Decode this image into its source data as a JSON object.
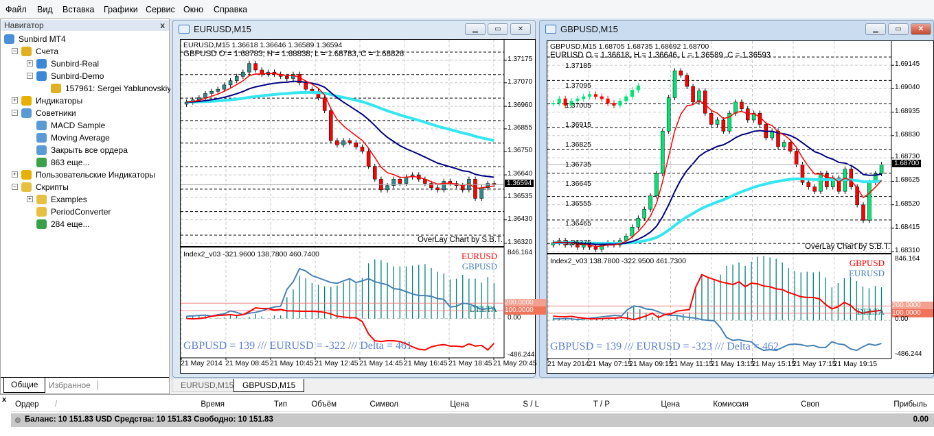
{
  "menu": [
    "Файл",
    "Вид",
    "Вставка",
    "Графики",
    "Сервис",
    "Окно",
    "Справка"
  ],
  "navigator": {
    "title": "Навигатор",
    "close": "x",
    "items": [
      {
        "label": "Sunbird MT4",
        "level": 0,
        "exp": "",
        "icon": "terminal"
      },
      {
        "label": "Счета",
        "level": 1,
        "exp": "−",
        "icon": "accounts"
      },
      {
        "label": "Sunbird-Real",
        "level": 2,
        "exp": "+",
        "icon": "server"
      },
      {
        "label": "Sunbird-Demo",
        "level": 2,
        "exp": "−",
        "icon": "server"
      },
      {
        "label": "157961: Sergei Yablunovskiy",
        "level": 3,
        "exp": "",
        "icon": "user"
      },
      {
        "label": "Индикаторы",
        "level": 1,
        "exp": "+",
        "icon": "indicator"
      },
      {
        "label": "Советники",
        "level": 1,
        "exp": "−",
        "icon": "expert"
      },
      {
        "label": "MACD Sample",
        "level": 2,
        "exp": "",
        "icon": "expert"
      },
      {
        "label": "Moving Average",
        "level": 2,
        "exp": "",
        "icon": "expert"
      },
      {
        "label": "Закрыть все ордера",
        "level": 2,
        "exp": "",
        "icon": "expert"
      },
      {
        "label": "863 еще...",
        "level": 2,
        "exp": "",
        "icon": "globe"
      },
      {
        "label": "Пользовательские Индикаторы",
        "level": 1,
        "exp": "+",
        "icon": "indicator"
      },
      {
        "label": "Скрипты",
        "level": 1,
        "exp": "−",
        "icon": "script"
      },
      {
        "label": "Examples",
        "level": 2,
        "exp": "+",
        "icon": "script"
      },
      {
        "label": "PeriodConverter",
        "level": 2,
        "exp": "",
        "icon": "script"
      },
      {
        "label": "284 еще...",
        "level": 2,
        "exp": "",
        "icon": "globe"
      }
    ],
    "tabs": [
      "Общие",
      "Избранное"
    ]
  },
  "colors": {
    "bull": "#00e676",
    "bear": "#ff0000",
    "ema_fast": "#ff0000",
    "ema_mid": "#000080",
    "ema_slow": "#33e6f0",
    "ind_red": "#ff0000",
    "ind_blue": "#4682b4",
    "delta": "#008080",
    "level": "#f08080",
    "teal_candle": "#2e8b8b"
  },
  "charts": [
    {
      "window_title": "EURUSD,M15",
      "active": false,
      "header": "EURUSD,M15  1.36618 1.36646 1.36589 1.36594",
      "overlay_info": "GBPUSD O = 1.68783, H = 1.68838, L = 1.68783, C = 1.68826",
      "watermark": "OverLay Chart by S.B.T.",
      "price_labels": [
        "1.37175",
        "1.37070",
        "1.36960",
        "1.36855",
        "1.36750",
        "1.36640",
        "1.36535",
        "1.36430",
        "1.36320"
      ],
      "current_price": "1.36594",
      "ylim": [
        1.36304,
        1.37271
      ],
      "overlay_labels": [],
      "overlay_ylim": [
        1.36332,
        1.37305
      ],
      "closes": [
        1.3698,
        1.3699,
        1.37,
        1.3702,
        1.3703,
        1.3704,
        1.3706,
        1.3708,
        1.371,
        1.3712,
        1.3716,
        1.3713,
        1.3711,
        1.3712,
        1.3711,
        1.371,
        1.3709,
        1.3711,
        1.3707,
        1.3704,
        1.3703,
        1.37,
        1.3694,
        1.368,
        1.3678,
        1.368,
        1.3679,
        1.3677,
        1.3675,
        1.3668,
        1.3662,
        1.3657,
        1.3659,
        1.3662,
        1.366,
        1.3663,
        1.3664,
        1.3662,
        1.366,
        1.3658,
        1.3657,
        1.3661,
        1.366,
        1.3659,
        1.3657,
        1.3662,
        1.3653,
        1.3658,
        1.366,
        1.36594
      ],
      "overlay_closes": [],
      "indicator": {
        "header": "Index2_v03 -321.9600 138.7800 460.7400",
        "legend": [
          "EURUSD",
          "GBPUSD",
          "DELTA"
        ],
        "axis_labels": [
          "846.164",
          "0.00",
          "-486.244"
        ],
        "levels": [
          "200.0000",
          "100.0000"
        ],
        "ylim": [
          -513,
          917.7
        ],
        "summary": "GBPUSD = 139 /// EURUSD = -322 /// Delta = 461",
        "red": [
          0,
          -5,
          0,
          10,
          30,
          40,
          45,
          50,
          40,
          50,
          90,
          140,
          130,
          130,
          110,
          120,
          100,
          100,
          95,
          95,
          95,
          90,
          80,
          60,
          30,
          20,
          10,
          10,
          -40,
          -200,
          -290,
          -300,
          -290,
          -290,
          -300,
          -330,
          -370,
          -400,
          -410,
          -370,
          -350,
          -340,
          -360,
          -360,
          -370,
          -330,
          -360,
          -350,
          -410,
          -322
        ],
        "blue": [
          30,
          35,
          40,
          45,
          30,
          50,
          60,
          100,
          80,
          50,
          70,
          80,
          100,
          130,
          150,
          160,
          380,
          480,
          650,
          620,
          560,
          530,
          500,
          470,
          460,
          490,
          520,
          470,
          490,
          520,
          480,
          460,
          440,
          390,
          380,
          350,
          320,
          300,
          300,
          290,
          260,
          250,
          150,
          160,
          200,
          190,
          160,
          120,
          130,
          139
        ]
      },
      "time_labels": [
        "21 May 2014",
        "21 May 08:45",
        "21 May 10:45",
        "21 May 12:45",
        "21 May 14:45",
        "21 May 16:45",
        "21 May 18:45",
        "21 May 20:45"
      ]
    },
    {
      "window_title": "GBPUSD,M15",
      "active": true,
      "header": "GBPUSD,M15  1.68705 1.68735 1.68692 1.68700",
      "overlay_info": "EURUSD O = 1.36618, H = 1.36646, L = 1.36589, C = 1.36593",
      "watermark": "OverLay Chart by S.B.T.",
      "price_labels": [
        "1.69145",
        "1.69040",
        "1.68935",
        "1.68830",
        "1.68730",
        "1.68625",
        "1.68520",
        "1.68415",
        "1.68310"
      ],
      "current_price": "1.68700",
      "ylim": [
        1.68301,
        1.69253
      ],
      "overlay_labels": [
        "1.37185",
        "1.37095",
        "1.37005",
        "1.36915",
        "1.36825",
        "1.36735",
        "1.36645",
        "1.36555",
        "1.36465",
        "1.36375"
      ],
      "overlay_ylim": [
        1.36332,
        1.37305
      ],
      "closes": [
        1.6835,
        1.6836,
        1.6834,
        1.6835,
        1.6833,
        1.6834,
        1.6833,
        1.6832,
        1.6834,
        1.6835,
        1.6834,
        1.6836,
        1.6838,
        1.6842,
        1.6846,
        1.685,
        1.6856,
        1.6866,
        1.6885,
        1.69,
        1.6912,
        1.691,
        1.6905,
        1.6898,
        1.6903,
        1.6893,
        1.6888,
        1.689,
        1.6885,
        1.6893,
        1.6898,
        1.6895,
        1.689,
        1.6893,
        1.6888,
        1.6882,
        1.6885,
        1.6878,
        1.688,
        1.6876,
        1.687,
        1.6862,
        1.686,
        1.6858,
        1.6866,
        1.686,
        1.6864,
        1.6858,
        1.6868,
        1.686,
        1.6852,
        1.6845,
        1.6862,
        1.6866,
        1.687
      ],
      "overlay_closes": [
        1.3702,
        1.3704,
        1.3701,
        1.3703,
        1.3704,
        1.3705,
        1.3706,
        1.3705,
        1.3704,
        1.3702,
        1.3701,
        1.3703,
        1.3705,
        1.3708,
        1.371
      ],
      "indicator": {
        "header": "Index2_v03 138.7800 -322.9500 461.7300",
        "legend": [
          "GBPUSD",
          "EURUSD",
          "DELTA"
        ],
        "axis_labels": [
          "846.164",
          "0.00",
          "-486.244"
        ],
        "levels": [
          "200.0000",
          "100.0000"
        ],
        "ylim": [
          -534.2,
          913.3
        ],
        "summary": "GBPUSD = 139 /// EURUSD = -323 /// Delta = 462",
        "red": [
          60,
          50,
          50,
          55,
          40,
          30,
          20,
          20,
          25,
          30,
          30,
          40,
          30,
          10,
          35,
          60,
          100,
          40,
          80,
          90,
          130,
          140,
          150,
          460,
          640,
          600,
          570,
          540,
          520,
          500,
          540,
          470,
          520,
          510,
          480,
          470,
          440,
          430,
          390,
          360,
          330,
          320,
          320,
          300,
          220,
          160,
          190,
          250,
          210,
          130,
          100,
          120,
          130,
          139
        ],
        "blue": [
          20,
          20,
          25,
          20,
          10,
          20,
          30,
          40,
          50,
          60,
          70,
          60,
          150,
          200,
          190,
          160,
          150,
          120,
          80,
          70,
          70,
          50,
          40,
          30,
          10,
          0,
          -5,
          -100,
          -240,
          -280,
          -270,
          -290,
          -300,
          -380,
          -420,
          -410,
          -420,
          -380,
          -340,
          -330,
          -340,
          -360,
          -350,
          -380,
          -380,
          -300,
          -330,
          -340,
          -400,
          -420,
          -370,
          -330,
          -350,
          -323
        ]
      },
      "time_labels": [
        "21 May 2014",
        "21 May 07:15",
        "21 May 09:15",
        "21 May 11:15",
        "21 May 13:15",
        "21 May 15:15",
        "21 May 17:15",
        "21 May 19:15"
      ]
    }
  ],
  "chart_tabs": [
    "EURUSD,M15",
    "GBPUSD,M15"
  ],
  "terminal": {
    "close": "x",
    "columns": [
      "Ордер",
      "Время",
      "Тип",
      "Объём",
      "Символ",
      "Цена",
      "S / L",
      "T / P",
      "Цена",
      "Комиссия",
      "Своп",
      "Прибыль"
    ],
    "sort_indicator": "/",
    "balance": "Баланс: 10 151.83 USD  Средства: 10 151.83  Свободно: 10 151.83",
    "profit": "0.00"
  }
}
